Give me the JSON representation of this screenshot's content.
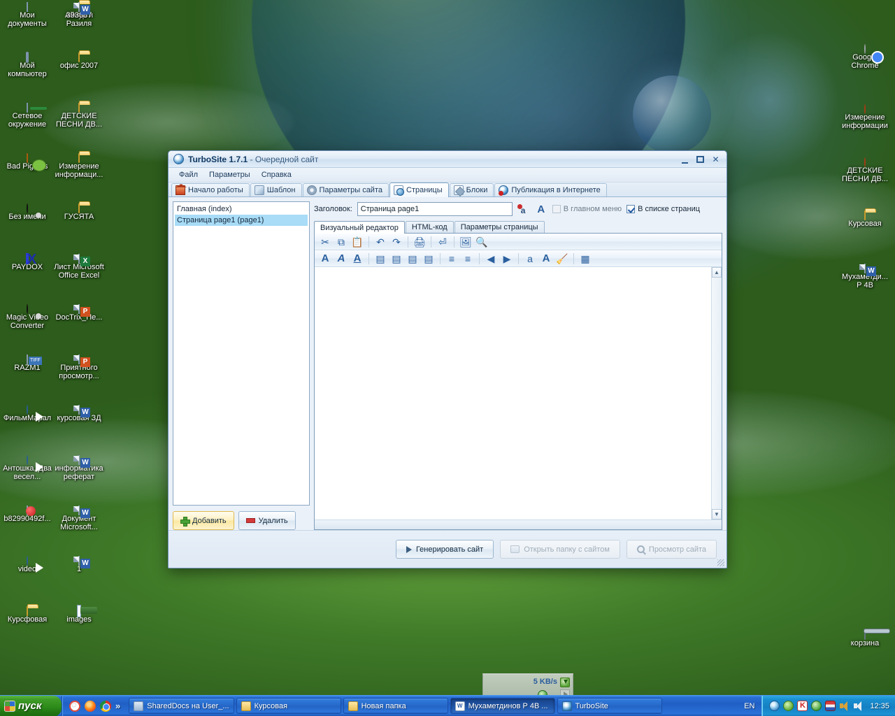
{
  "desktop": {
    "icons_left": [
      {
        "label": "Мои документы",
        "icon": "my-documents-icon",
        "kind": "mydocs"
      },
      {
        "label": "Айнур и Разиля",
        "icon": "folder-icon",
        "kind": "folder"
      },
      {
        "label": "393887",
        "icon": "word-document-icon",
        "kind": "word"
      },
      {
        "label": "Мой компьютер",
        "icon": "my-computer-icon",
        "kind": "comp"
      },
      {
        "label": "офис 2007",
        "icon": "folder-icon",
        "kind": "folder"
      },
      {
        "label": "Сетевое окружение",
        "icon": "network-places-icon",
        "kind": "net"
      },
      {
        "label": "ДЕТСКИЕ ПЕСНИ ДВ...",
        "icon": "folder-icon",
        "kind": "folder"
      },
      {
        "label": "Bad Piggies",
        "icon": "bad-piggies-icon",
        "kind": "pig"
      },
      {
        "label": "Измерение информаци...",
        "icon": "folder-icon",
        "kind": "folder"
      },
      {
        "label": "Без имени",
        "icon": "video-file-icon",
        "kind": "reel"
      },
      {
        "label": "ГУСЯТА",
        "icon": "folder-icon",
        "kind": "folder"
      },
      {
        "label": "PAYDOX",
        "icon": "paydox-icon",
        "kind": "paydox"
      },
      {
        "label": "Лист Microsoft Office Excel",
        "icon": "excel-document-icon",
        "kind": "excel"
      },
      {
        "label": "Magic Video Converter",
        "icon": "video-file-icon",
        "kind": "reel"
      },
      {
        "label": "DocTrix_Пе...",
        "icon": "powerpoint-document-icon",
        "kind": "ppt"
      },
      {
        "label": "RAZM1",
        "icon": "tiff-image-icon",
        "kind": "tiff"
      },
      {
        "label": "Приятного просмотр...",
        "icon": "powerpoint-document-icon",
        "kind": "ppt"
      },
      {
        "label": "ФильмМарал",
        "icon": "media-player-file-icon",
        "kind": "media"
      },
      {
        "label": "курсовая ЗД",
        "icon": "word-document-icon",
        "kind": "word"
      },
      {
        "label": "Антошка, Два весел...",
        "icon": "media-player-file-icon",
        "kind": "media"
      },
      {
        "label": "информатика реферат",
        "icon": "word-document-icon",
        "kind": "word"
      },
      {
        "label": "b82990492f...",
        "icon": "flash-video-icon",
        "kind": "flash"
      },
      {
        "label": "Документ Microsoft...",
        "icon": "word-document-icon",
        "kind": "word"
      },
      {
        "label": "video",
        "icon": "media-player-file-icon",
        "kind": "media"
      },
      {
        "label": "1",
        "icon": "word-document-icon",
        "kind": "word"
      },
      {
        "label": "Курсфовая",
        "icon": "folder-icon",
        "kind": "folder"
      },
      {
        "label": "images",
        "icon": "image-file-icon",
        "kind": "image"
      }
    ],
    "icons_right": [
      {
        "label": "Google Chrome",
        "icon": "google-chrome-icon",
        "kind": "chrome"
      },
      {
        "label": "Измерение информации",
        "icon": "firefox-html-icon",
        "kind": "ff"
      },
      {
        "label": "ДЕТСКИЕ ПЕСНИ ДВ...",
        "icon": "firefox-html-icon",
        "kind": "ff"
      },
      {
        "label": "Курсовая",
        "icon": "folder-icon",
        "kind": "folder"
      },
      {
        "label": "Мухаметди... Р 4В",
        "icon": "word-document-icon",
        "kind": "word"
      },
      {
        "label": "корзина",
        "icon": "recycle-bin-icon",
        "kind": "trash"
      }
    ]
  },
  "speed_popup": {
    "rate": "5 KB/s"
  },
  "window": {
    "title_app": "TurboSite 1.7.1",
    "title_doc": "- Очередной сайт",
    "minimize_label": "_",
    "maximize_label": "□",
    "close_label": "✕",
    "menu": [
      "Файл",
      "Параметры",
      "Справка"
    ],
    "tabs": [
      {
        "label": "Начало работы",
        "icon": "home-icon",
        "kind": "home",
        "selected": false
      },
      {
        "label": "Шаблон",
        "icon": "brush-icon",
        "kind": "brush",
        "selected": false
      },
      {
        "label": "Параметры сайта",
        "icon": "gear-icon",
        "kind": "gear",
        "selected": false
      },
      {
        "label": "Страницы",
        "icon": "pages-icon",
        "kind": "pages",
        "selected": true
      },
      {
        "label": "Блоки",
        "icon": "blocks-icon",
        "kind": "blocks",
        "selected": false
      },
      {
        "label": "Публикация в Интернете",
        "icon": "publish-globe-icon",
        "kind": "pub",
        "selected": false
      }
    ],
    "page_list": [
      {
        "label": "Главная (index)",
        "selected": false
      },
      {
        "label": "Страница page1 (page1)",
        "selected": true
      }
    ],
    "left_buttons": {
      "add": "Добавить",
      "delete": "Удалить"
    },
    "header": {
      "title_label": "Заголовок:",
      "title_value": "Страница page1",
      "title_placeholder": "",
      "checkbox_main_menu": "В главном меню",
      "checkbox_main_menu_checked": false,
      "checkbox_page_list": "В списке страниц",
      "checkbox_page_list_checked": true
    },
    "editor_tabs": [
      {
        "label": "Визуальный редактор",
        "selected": true
      },
      {
        "label": "HTML-код",
        "selected": false
      },
      {
        "label": "Параметры страницы",
        "selected": false
      }
    ],
    "toolbar_row1": [
      {
        "name": "cut-icon",
        "glyph": "✂"
      },
      {
        "name": "copy-icon",
        "glyph": "⧉"
      },
      {
        "name": "paste-icon",
        "glyph": "📋"
      },
      {
        "name": "undo-icon",
        "glyph": "↶"
      },
      {
        "name": "redo-icon",
        "glyph": "↷"
      },
      {
        "name": "print-icon",
        "glyph": "🖨"
      },
      {
        "name": "insert-break-icon",
        "glyph": "⏎"
      },
      {
        "name": "insert-image-icon",
        "glyph": "🖼"
      },
      {
        "name": "find-icon",
        "glyph": "🔍"
      }
    ],
    "toolbar_row2": [
      {
        "name": "bold-icon",
        "glyph": "A"
      },
      {
        "name": "italic-icon",
        "glyph": "A"
      },
      {
        "name": "underline-icon",
        "glyph": "A"
      },
      {
        "name": "align-left-icon",
        "glyph": "▤"
      },
      {
        "name": "align-center-icon",
        "glyph": "▤"
      },
      {
        "name": "align-right-icon",
        "glyph": "▤"
      },
      {
        "name": "align-justify-icon",
        "glyph": "▤"
      },
      {
        "name": "ordered-list-icon",
        "glyph": "≡"
      },
      {
        "name": "unordered-list-icon",
        "glyph": "≡"
      },
      {
        "name": "outdent-icon",
        "glyph": "◀"
      },
      {
        "name": "indent-icon",
        "glyph": "▶"
      },
      {
        "name": "insert-link-icon",
        "glyph": "a"
      },
      {
        "name": "font-color-icon",
        "glyph": "A"
      },
      {
        "name": "clear-format-icon",
        "glyph": "🧹"
      },
      {
        "name": "insert-table-icon",
        "glyph": "▦"
      }
    ],
    "editor_content": "",
    "footer_buttons": [
      {
        "label": "Генерировать сайт",
        "icon": "play-triangle-icon",
        "enabled": true
      },
      {
        "label": "Открыть папку с сайтом",
        "icon": "folder-icon",
        "enabled": false
      },
      {
        "label": "Просмотр сайта",
        "icon": "magnifier-icon",
        "enabled": false
      }
    ]
  },
  "taskbar": {
    "start_label": "пуск",
    "quicklaunch": [
      {
        "name": "opera-icon"
      },
      {
        "name": "firefox-icon"
      },
      {
        "name": "chrome-icon"
      },
      {
        "name": "more-chevron-icon",
        "label": "»"
      }
    ],
    "tasks": [
      {
        "label": "SharedDocs на User_...",
        "icon": "shared-docs-icon",
        "kind": "shared",
        "active": false
      },
      {
        "label": "Курсовая",
        "icon": "folder-icon",
        "kind": "folder",
        "active": false
      },
      {
        "label": "Новая папка",
        "icon": "folder-icon",
        "kind": "folder",
        "active": false
      },
      {
        "label": "Мухаметдинов Р 4В ...",
        "icon": "word-document-icon",
        "kind": "word",
        "active": true
      },
      {
        "label": "TurboSite",
        "icon": "turbosite-icon",
        "kind": "turbo",
        "active": false
      }
    ],
    "language": "EN",
    "tray_icons": [
      {
        "name": "network-globe-icon",
        "kind": "globe"
      },
      {
        "name": "safely-remove-hardware-icon",
        "kind": "green"
      },
      {
        "name": "kaspersky-icon",
        "kind": "k"
      },
      {
        "name": "earth-update-icon",
        "kind": "earth"
      },
      {
        "name": "language-flag-icon",
        "kind": "flag"
      },
      {
        "name": "volume-icon",
        "kind": "spk"
      },
      {
        "name": "volume-secondary-icon",
        "kind": "spk2"
      }
    ],
    "clock": "12:35"
  },
  "colors": {
    "taskbar_blue": "#2a6fd4",
    "start_green": "#3f9b27",
    "selection_blue": "#a8dcf7",
    "tray_cyan": "#1a8fd0"
  }
}
